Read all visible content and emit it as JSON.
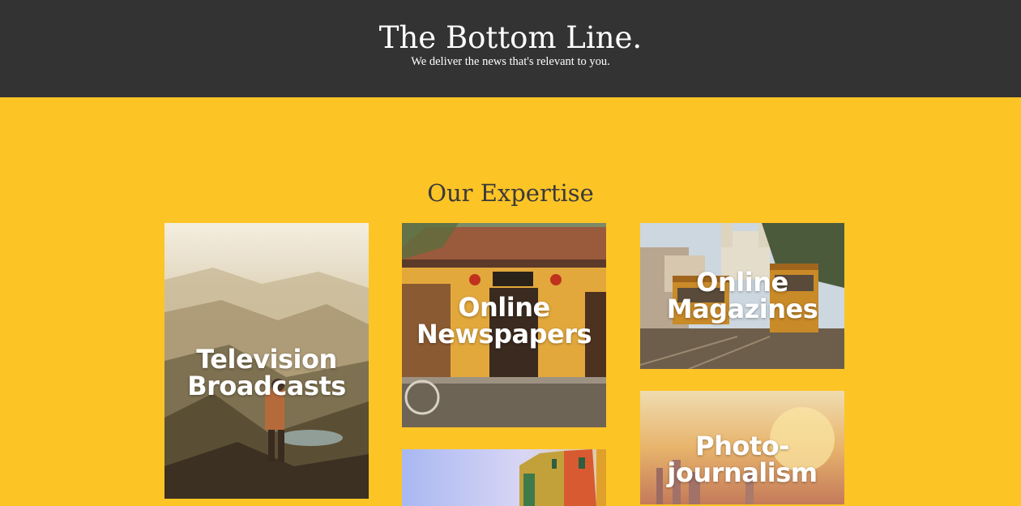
{
  "header": {
    "title": "The Bottom Line.",
    "tagline": "We deliver the news that's relevant to you."
  },
  "expertise": {
    "heading": "Our Expertise",
    "tiles": [
      {
        "label": "Television\nBroadcasts",
        "image": "mountain-hiker"
      },
      {
        "label": "Online\nNewspapers",
        "image": "yellow-storefront"
      },
      {
        "label": "Online\nMagazines",
        "image": "city-trams"
      },
      {
        "label": "Photo-\njournalism",
        "image": "sunset-skyline"
      },
      {
        "label": "",
        "image": "colorful-street"
      }
    ]
  },
  "colors": {
    "header_bg": "#333333",
    "page_bg": "#fdc426",
    "heading_text": "#3a3a3a"
  }
}
